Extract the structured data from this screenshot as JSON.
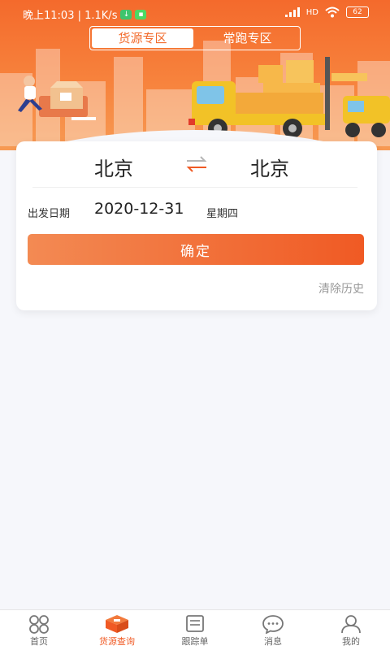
{
  "status_bar": {
    "time_text": "晚上11:03 | 1.1K/s",
    "battery": "62",
    "network_label": "HD"
  },
  "segment_tabs": [
    {
      "label": "货源专区",
      "active": true
    },
    {
      "label": "常跑专区",
      "active": false
    }
  ],
  "route": {
    "from_city": "北京",
    "to_city": "北京"
  },
  "date": {
    "label": "出发日期",
    "value": "2020-12-31",
    "weekday": "星期四"
  },
  "actions": {
    "confirm_label": "确定",
    "clear_history_label": "清除历史"
  },
  "bottom_nav": [
    {
      "label": "首页",
      "icon": "home-grid-icon",
      "active": false
    },
    {
      "label": "货源查询",
      "icon": "cargo-box-icon",
      "active": true
    },
    {
      "label": "跟踪单",
      "icon": "document-icon",
      "active": false
    },
    {
      "label": "消息",
      "icon": "chat-bubble-icon",
      "active": false
    },
    {
      "label": "我的",
      "icon": "user-icon",
      "active": false
    }
  ],
  "colors": {
    "accent": "#f05a24",
    "banner": "#f46a2c"
  }
}
